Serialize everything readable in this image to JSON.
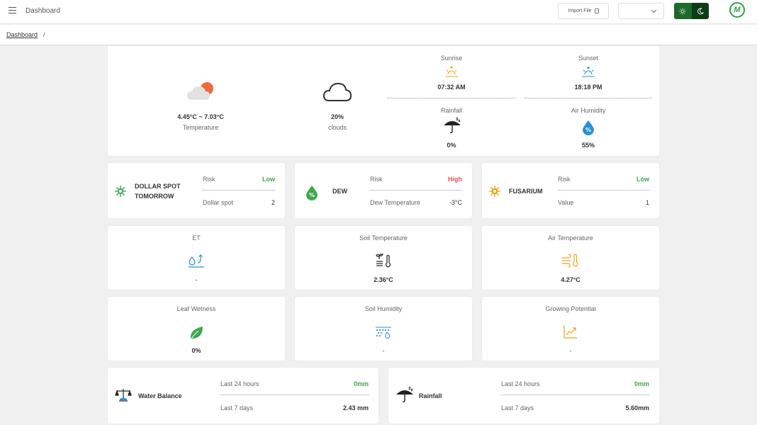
{
  "header": {
    "title": "Dashboard",
    "import_label": "Import File",
    "select_value": "",
    "colors": {
      "brand": "#2ba14a",
      "toggle_light": "#1d6a2a",
      "toggle_dark": "#0c3d16"
    }
  },
  "breadcrumb": {
    "link": "Dashboard",
    "separator": "/"
  },
  "weather": {
    "temperature_value": "4.45°C ~ 7.03°C",
    "temperature_label": "Temperature",
    "clouds_value": "20%",
    "clouds_label": "clouds",
    "sunrise_label": "Sunrise",
    "sunrise_value": "07:32 AM",
    "sunset_label": "Sunset",
    "sunset_value": "18:18 PM",
    "rainfall_label": "Rainfall",
    "rainfall_value": "0%",
    "humidity_label": "Air Humidity",
    "humidity_value": "55%"
  },
  "risks": [
    {
      "title_line1": "DOLLAR SPOT",
      "title_line2": "TOMORROW",
      "risk_label": "Risk",
      "risk_value": "Low",
      "metric_label": "Dollar spot",
      "metric_value": "2",
      "icon": "virus-icon"
    },
    {
      "title_line1": "DEW",
      "title_line2": "",
      "risk_label": "Risk",
      "risk_value": "High",
      "metric_label": "Dew Temperature",
      "metric_value": "-3°C",
      "icon": "dew-percent-icon"
    },
    {
      "title_line1": "FUSARIUM",
      "title_line2": "",
      "risk_label": "Risk",
      "risk_value": "Low",
      "metric_label": "Value",
      "metric_value": "1",
      "icon": "fungus-icon"
    }
  ],
  "metrics": [
    {
      "label": "ET",
      "value": "-",
      "icon": "evapotranspiration-icon"
    },
    {
      "label": "Soil Temperature",
      "value": "2.36°C",
      "icon": "soil-thermometer-icon"
    },
    {
      "label": "Air Temperature",
      "value": "4.27°C",
      "icon": "wind-thermometer-icon"
    },
    {
      "label": "Leaf Wetness",
      "value": "0%",
      "icon": "leaf-icon"
    },
    {
      "label": "Soil Humidity",
      "value": "-",
      "icon": "soil-drop-icon"
    },
    {
      "label": "Growing Potential",
      "value": "-",
      "icon": "growth-chart-icon"
    }
  ],
  "balances": [
    {
      "title": "Water Balance",
      "row1_label": "Last 24 hours",
      "row1_value": "0mm",
      "row2_label": "Last 7 days",
      "row2_value": "2.43 mm",
      "icon": "balance-scale-icon"
    },
    {
      "title": "Rainfall",
      "row1_label": "Last 24 hours",
      "row1_value": "0mm",
      "row2_label": "Last 7 days",
      "row2_value": "5.60mm",
      "icon": "umbrella-rain-icon"
    }
  ]
}
